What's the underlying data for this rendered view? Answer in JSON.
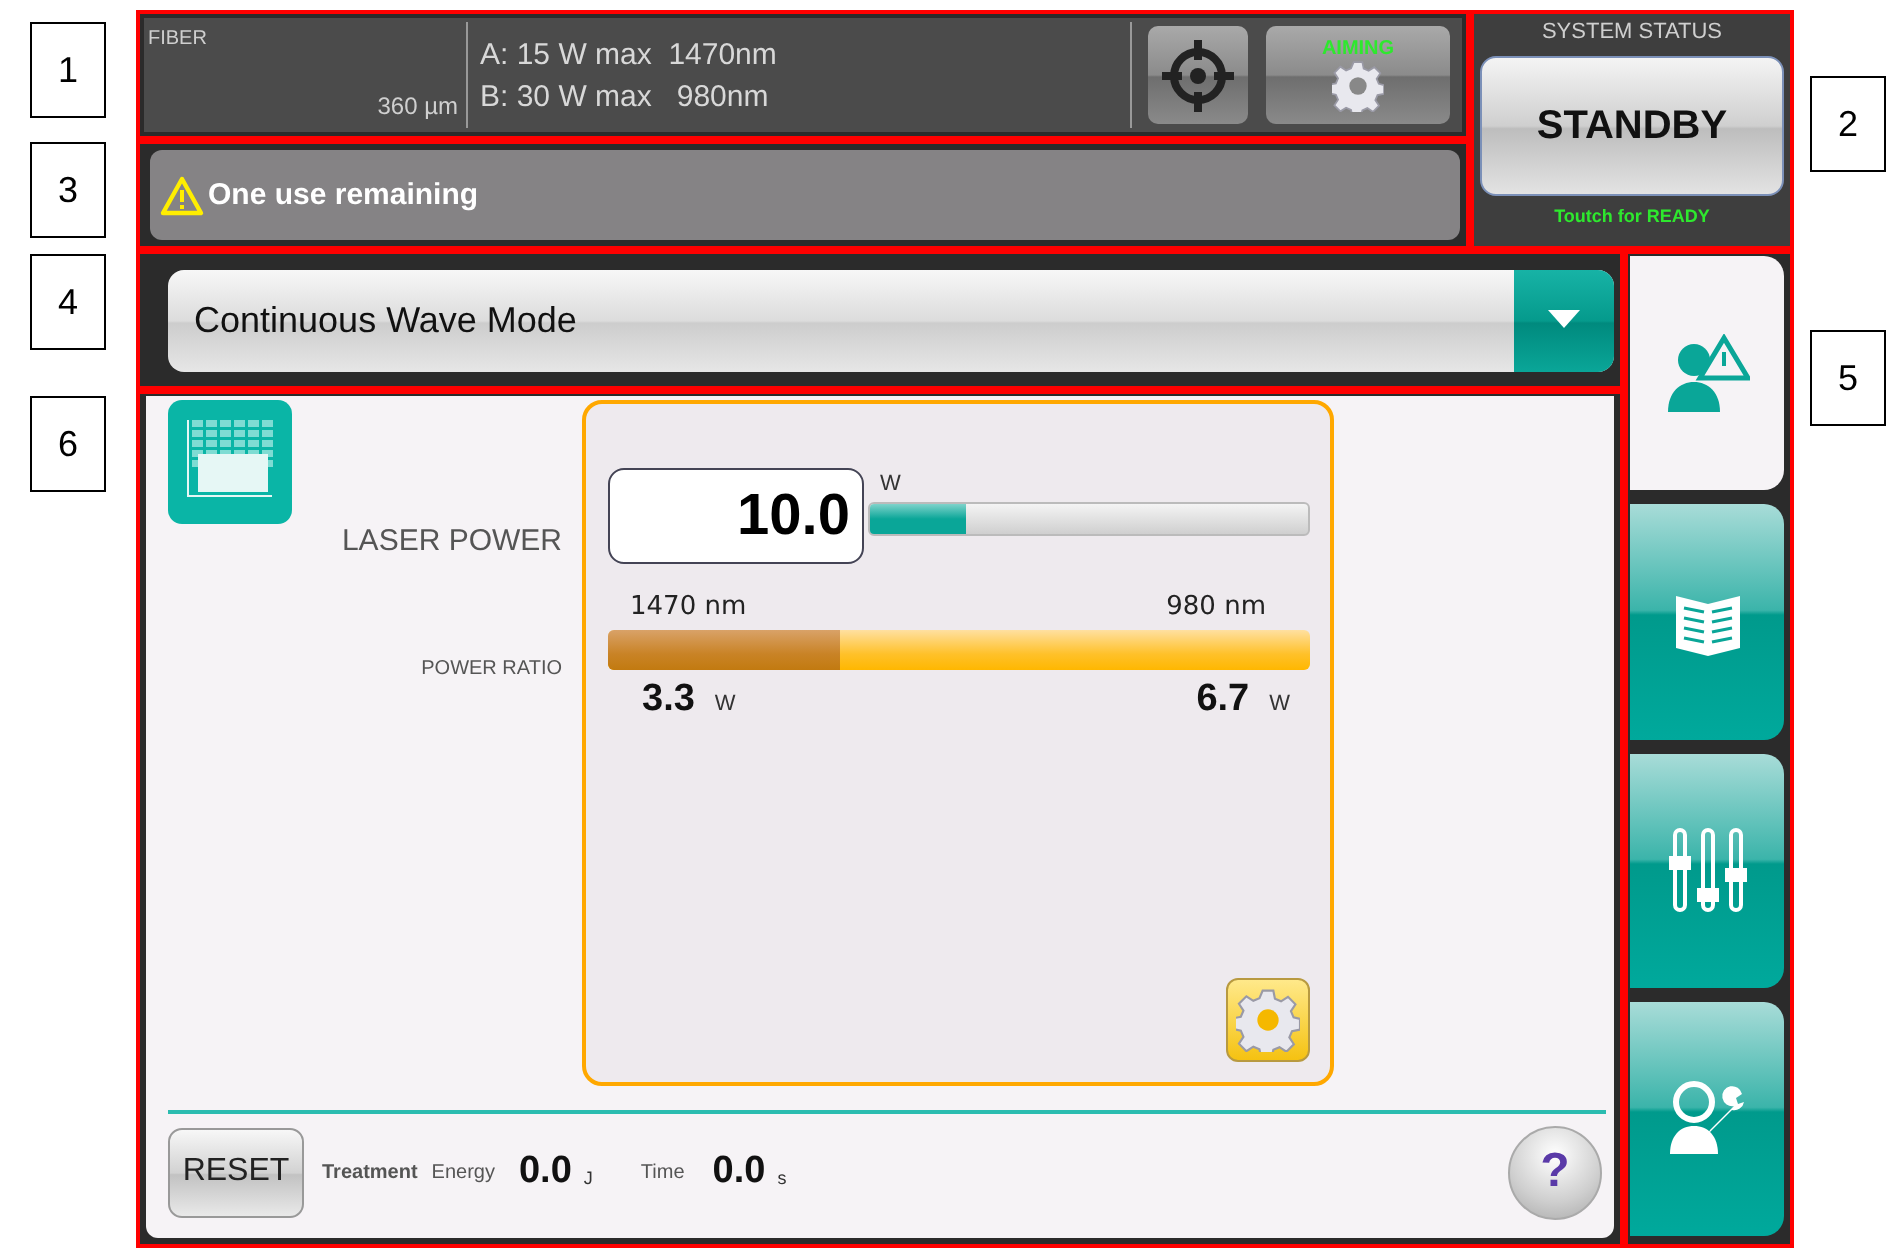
{
  "callouts": [
    "1",
    "2",
    "3",
    "4",
    "5",
    "6"
  ],
  "fiber": {
    "label": "FIBER",
    "size": "360 µm"
  },
  "sources": [
    "A: 15 W max  1470nm",
    "B: 30 W max   980nm"
  ],
  "aiming": {
    "label": "AIMING"
  },
  "system_status": {
    "title": "SYSTEM STATUS",
    "state": "STANDBY",
    "hint": "Toutch for READY"
  },
  "warning": "One use remaining",
  "mode": {
    "value": "Continuous Wave Mode"
  },
  "laser_power": {
    "label": "LASER POWER",
    "value": "10.0",
    "unit": "W",
    "level": 0.22
  },
  "power_ratio": {
    "label": "POWER RATIO",
    "level": 0.33,
    "left": {
      "wavelength": "1470 nm",
      "value": "3.3",
      "unit": "W"
    },
    "right": {
      "wavelength": "980 nm",
      "value": "6.7",
      "unit": "W"
    }
  },
  "footer": {
    "reset": "RESET",
    "treatment": "Treatment",
    "energy_label": "Energy",
    "energy": "0.0",
    "energy_unit": "J",
    "time_label": "Time",
    "time": "0.0",
    "time_unit": "s",
    "help": "?"
  },
  "tabs": [
    {
      "kind": "doctor",
      "selected": true
    },
    {
      "kind": "book",
      "selected": false
    },
    {
      "kind": "sliders",
      "selected": false
    },
    {
      "kind": "user-tools",
      "selected": false
    }
  ]
}
